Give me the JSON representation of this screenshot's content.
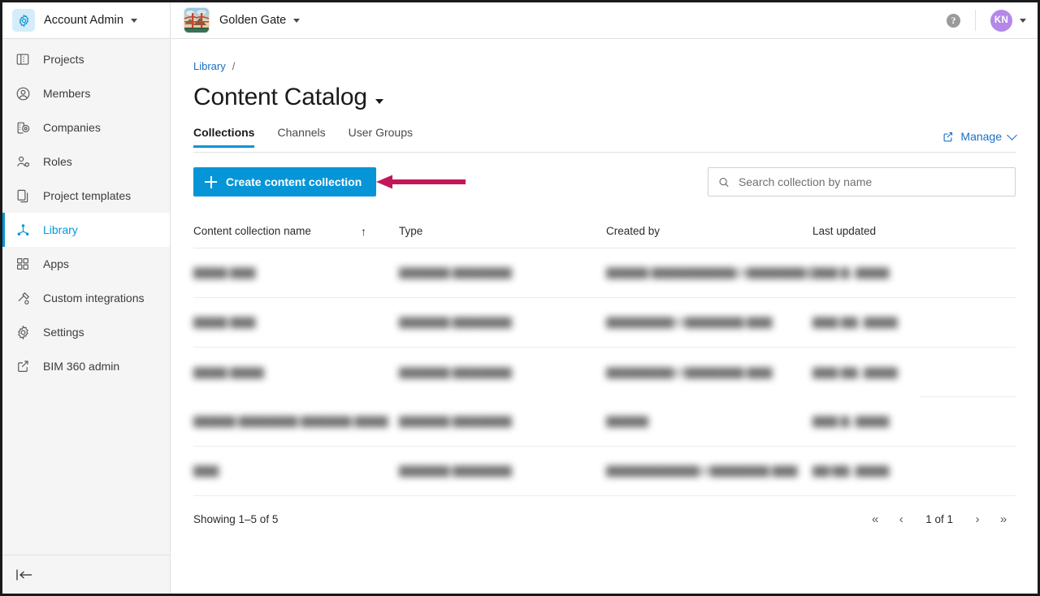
{
  "topbar": {
    "gear_icon": "gear-icon",
    "account_title": "Account Admin",
    "project_name": "Golden Gate",
    "help_icon": "?",
    "avatar_initials": "KN"
  },
  "sidebar": {
    "items": [
      {
        "label": "Projects",
        "icon": "building-icon",
        "active": false
      },
      {
        "label": "Members",
        "icon": "user-circle-icon",
        "active": false
      },
      {
        "label": "Companies",
        "icon": "company-pin-icon",
        "active": false
      },
      {
        "label": "Roles",
        "icon": "user-gear-icon",
        "active": false
      },
      {
        "label": "Project templates",
        "icon": "copy-icon",
        "active": false
      },
      {
        "label": "Library",
        "icon": "library-node-icon",
        "active": true
      },
      {
        "label": "Apps",
        "icon": "grid-squares-icon",
        "active": false
      },
      {
        "label": "Custom integrations",
        "icon": "hammer-icon",
        "active": false
      },
      {
        "label": "Settings",
        "icon": "gear-icon",
        "active": false
      },
      {
        "label": "BIM 360 admin",
        "icon": "external-link-icon",
        "active": false
      }
    ],
    "collapse_icon": "collapse-sidebar-icon"
  },
  "breadcrumb": {
    "root": "Library",
    "separator": "/"
  },
  "page": {
    "title": "Content Catalog",
    "title_caret": "chevron-down-icon"
  },
  "tabs": [
    {
      "label": "Collections",
      "selected": true
    },
    {
      "label": "Channels",
      "selected": false
    },
    {
      "label": "User Groups",
      "selected": false
    }
  ],
  "manage": {
    "label": "Manage",
    "external_icon": "external-link-icon",
    "chevron_icon": "chevron-down-icon"
  },
  "toolbar": {
    "create_label": "Create content collection",
    "create_icon": "plus-icon",
    "create_color": "#0696d7",
    "annotation_arrow": {
      "name": "annotation-arrow-left",
      "color": "#c2185b"
    }
  },
  "search": {
    "placeholder": "Search collection by name",
    "value": "",
    "icon": "search-icon"
  },
  "table": {
    "columns": [
      {
        "label": "Content collection name",
        "sort_icon": "sort-asc-arrow"
      },
      {
        "label": "Type"
      },
      {
        "label": "Created by"
      },
      {
        "label": "Last updated"
      }
    ],
    "rows": [
      {
        "name": "▇▇▇▇ ▇▇▇",
        "type": "▇▇▇▇▇▇ ▇▇▇▇▇▇▇",
        "created_by": "▇▇▇▇▇ ▇▇▇▇▇▇▇▇▇▇@▇▇▇▇▇▇▇.▇▇▇",
        "last_updated": "▇▇▇ ▇, ▇▇▇▇",
        "redacted": true
      },
      {
        "name": "▇▇▇▇ ▇▇▇",
        "type": "▇▇▇▇▇▇ ▇▇▇▇▇▇▇",
        "created_by": "▇▇▇▇▇▇▇▇@▇▇▇▇▇▇▇.▇▇▇",
        "last_updated": "▇▇▇ ▇▇, ▇▇▇▇",
        "redacted": true
      },
      {
        "name": "▇▇▇▇ ▇▇▇▇",
        "type": "▇▇▇▇▇▇ ▇▇▇▇▇▇▇",
        "created_by": "▇▇▇▇▇▇▇▇@▇▇▇▇▇▇▇.▇▇▇",
        "last_updated": "▇▇▇ ▇▇, ▇▇▇▇",
        "redacted": true
      },
      {
        "name": "▇▇▇▇▇ ▇▇▇▇▇▇▇ ▇▇▇▇▇▇ ▇▇▇▇",
        "type": "▇▇▇▇▇▇ ▇▇▇▇▇▇▇",
        "created_by": "▇▇▇▇▇",
        "last_updated": "▇▇▇ ▇, ▇▇▇▇",
        "redacted": true
      },
      {
        "name": "▇▇▇",
        "type": "▇▇▇▇▇▇ ▇▇▇▇▇▇▇",
        "created_by": "▇▇▇▇▇▇▇▇▇▇▇@▇▇▇▇▇▇▇.▇▇▇",
        "last_updated": "▇▇/▇▇, ▇▇▇▇",
        "redacted": true
      }
    ]
  },
  "footer": {
    "showing": "Showing 1–5 of 5",
    "page_indicator": "1 of 1",
    "first_icon": "«",
    "prev_icon": "‹",
    "next_icon": "›",
    "last_icon": "»"
  }
}
